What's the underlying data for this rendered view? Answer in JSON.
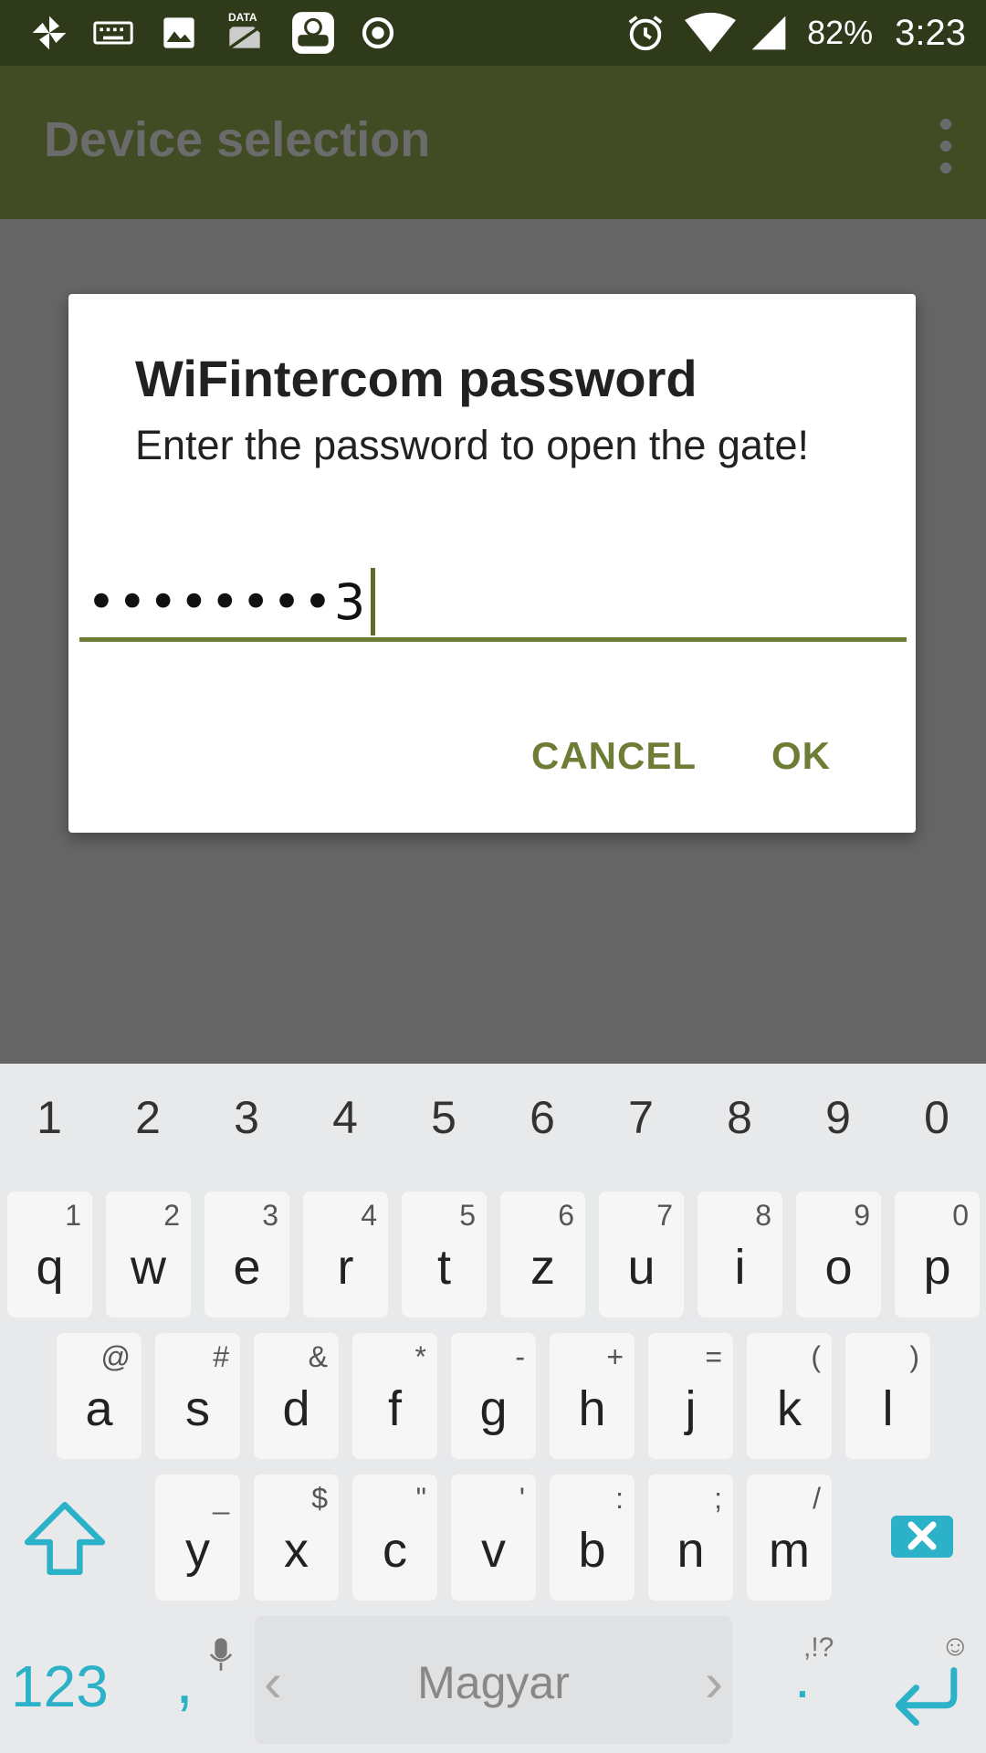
{
  "status_bar": {
    "battery": "82%",
    "time": "3:23",
    "icons": [
      "pinwheel-icon",
      "keyboard-icon",
      "image-icon",
      "data-sim-icon",
      "lock-notification-icon",
      "target-icon",
      "alarm-icon",
      "wifi-icon",
      "cell-signal-icon"
    ],
    "data_label": "DATA"
  },
  "app_bar": {
    "title": "Device selection",
    "overflow_icon": "more-vert-icon"
  },
  "dialog": {
    "title": "WiFintercom password",
    "message": "Enter the password to open the gate!",
    "password_masked": "••••••••3",
    "cancel_label": "CANCEL",
    "ok_label": "OK",
    "accent_color": "#6e7d36"
  },
  "keyboard": {
    "number_row": [
      "1",
      "2",
      "3",
      "4",
      "5",
      "6",
      "7",
      "8",
      "9",
      "0"
    ],
    "row1": [
      {
        "key": "q",
        "hint": "1"
      },
      {
        "key": "w",
        "hint": "2"
      },
      {
        "key": "e",
        "hint": "3"
      },
      {
        "key": "r",
        "hint": "4"
      },
      {
        "key": "t",
        "hint": "5"
      },
      {
        "key": "z",
        "hint": "6"
      },
      {
        "key": "u",
        "hint": "7"
      },
      {
        "key": "i",
        "hint": "8"
      },
      {
        "key": "o",
        "hint": "9"
      },
      {
        "key": "p",
        "hint": "0"
      }
    ],
    "row2": [
      {
        "key": "a",
        "hint": "@"
      },
      {
        "key": "s",
        "hint": "#"
      },
      {
        "key": "d",
        "hint": "&"
      },
      {
        "key": "f",
        "hint": "*"
      },
      {
        "key": "g",
        "hint": "-"
      },
      {
        "key": "h",
        "hint": "+"
      },
      {
        "key": "j",
        "hint": "="
      },
      {
        "key": "k",
        "hint": "("
      },
      {
        "key": "l",
        "hint": ")"
      }
    ],
    "row3": [
      {
        "key": "y",
        "hint": "_"
      },
      {
        "key": "x",
        "hint": "$"
      },
      {
        "key": "c",
        "hint": "\""
      },
      {
        "key": "v",
        "hint": "'"
      },
      {
        "key": "b",
        "hint": ":"
      },
      {
        "key": "n",
        "hint": ";"
      },
      {
        "key": "m",
        "hint": "/"
      }
    ],
    "mode_label": "123",
    "comma": ",",
    "space_label": "Magyar",
    "period": ".",
    "punct_hint": ",!?",
    "accent_color": "#2bb1c8"
  }
}
